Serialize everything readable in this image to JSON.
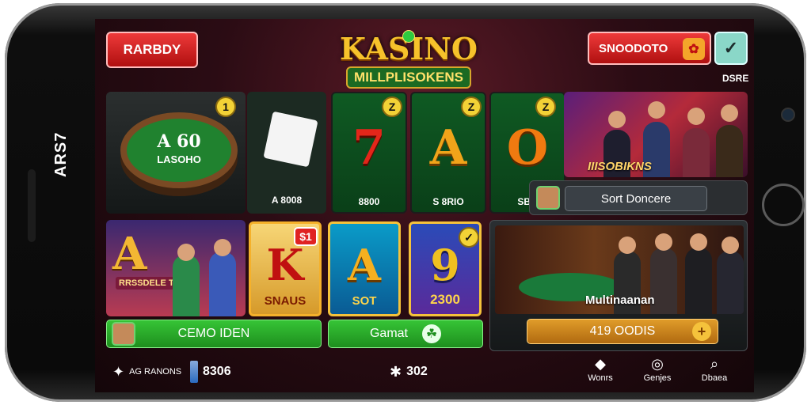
{
  "device": {
    "side_text": "ARS7"
  },
  "header": {
    "left_button": "RARBDY",
    "logo_line1": "KASINO",
    "logo_line2": "MILLPLISOKENS",
    "right_button": "SNOODOTO",
    "right_badge": "✿",
    "check_icon": "✓",
    "corner_label": "DSRE"
  },
  "tiles_top": {
    "felt": {
      "badge": "1",
      "title": "A 60",
      "subtitle": "LASOHO"
    },
    "cards": {
      "caption": "A 8008"
    },
    "t7": {
      "badge": "Z",
      "symbol": "7",
      "caption": "8800",
      "color": "#e3261a"
    },
    "tA": {
      "badge": "Z",
      "symbol": "A",
      "caption": "S 8RIO",
      "color": "#f0a41a"
    },
    "tO": {
      "badge": "Z",
      "symbol": "O",
      "caption": "SBR",
      "color": "#f07a10"
    },
    "live": {
      "title": "IIISOBIKNS",
      "button": "Sort Doncere"
    }
  },
  "tiles_bottom": {
    "ak": {
      "big": "A",
      "sub": "RRSSDELE TRES"
    },
    "k": {
      "badge": "$1",
      "symbol": "K",
      "label": "SNAUS"
    },
    "a": {
      "symbol": "A",
      "label": "SOT"
    },
    "nine": {
      "badge": "✓",
      "symbol": "9",
      "label": "2300"
    },
    "multi": {
      "caption": "Multinaanan",
      "coins": "419 OODIS",
      "plus": "+"
    }
  },
  "buttons": {
    "demo": "CEMO IDEN",
    "game": "Gamat",
    "game_icon": "☘"
  },
  "bottom_nav": {
    "left_label": "AG RANONS",
    "chips_value": "8306",
    "center_value": "302",
    "items": [
      {
        "label": "Wonrs",
        "icon": "diamond-icon"
      },
      {
        "label": "Genjes",
        "icon": "target-icon"
      },
      {
        "label": "Dbaea",
        "icon": "search-icon"
      }
    ]
  },
  "colors": {
    "accent_red": "#e02222",
    "felt_green": "#20822f",
    "gold": "#f5c23b",
    "button_green": "#2eb82e"
  }
}
